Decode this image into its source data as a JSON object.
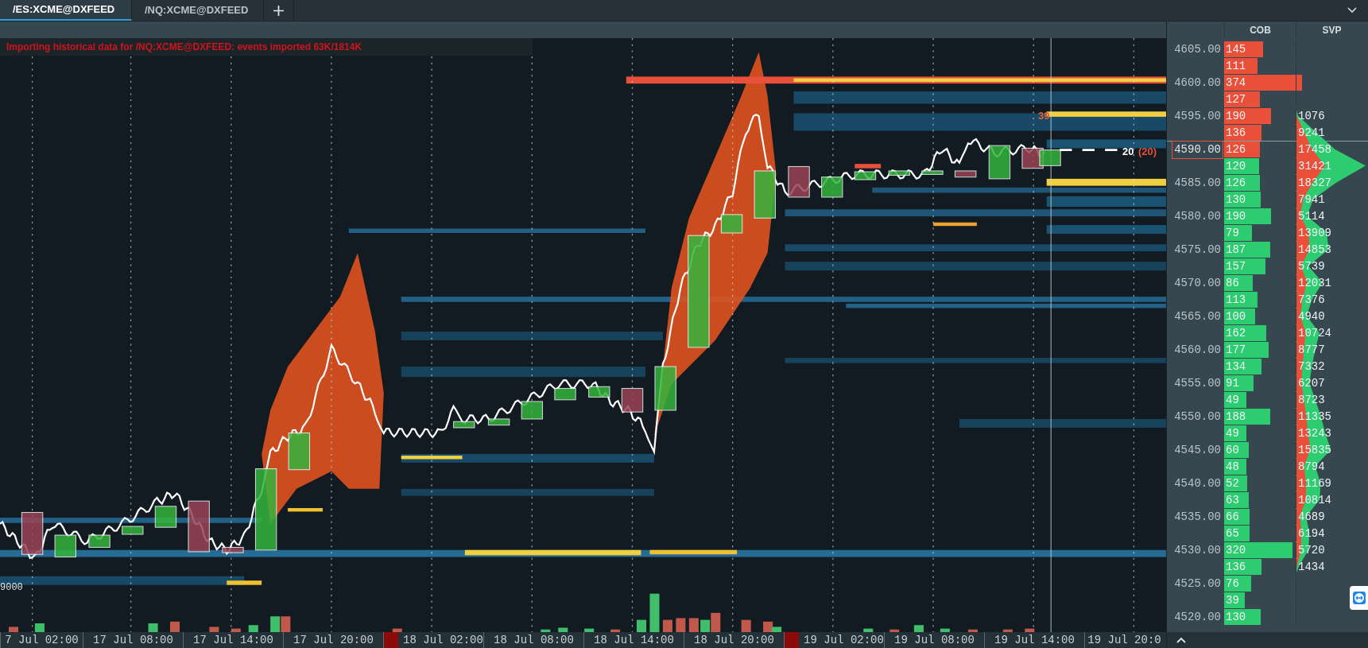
{
  "tabs": [
    {
      "label": "/ES:XCME@DXFEED",
      "selected": true
    },
    {
      "label": "/NQ:XCME@DXFEED",
      "selected": false
    }
  ],
  "status_message": "Importing historical data for /NQ:XCME@DXFEED: events imported 63K/1814K",
  "chart": {
    "left_label": "9000",
    "order_labels": [
      {
        "text": "39",
        "color": "#e8603a"
      }
    ],
    "current_order": {
      "size": "20",
      "total": "(20)"
    }
  },
  "time_axis": [
    {
      "label": "7 Jul 02:00",
      "marked": false
    },
    {
      "label": "17 Jul 08:00",
      "marked": false
    },
    {
      "label": "17 Jul 14:00",
      "marked": false
    },
    {
      "label": "17 Jul 20:00",
      "marked": false
    },
    {
      "label": "18 Jul 02:00",
      "marked": true
    },
    {
      "label": "18 Jul 08:00",
      "marked": false
    },
    {
      "label": "18 Jul 14:00",
      "marked": false
    },
    {
      "label": "18 Jul 20:00",
      "marked": false
    },
    {
      "label": "19 Jul 02:00",
      "marked": true
    },
    {
      "label": "19 Jul 08:00",
      "marked": false
    },
    {
      "label": "19 Jul 14:00",
      "marked": false
    },
    {
      "label": "19 Jul 20:0",
      "marked": false
    }
  ],
  "profile": {
    "columns": [
      "COB",
      "SVP"
    ],
    "rows": [
      {
        "price": "4605.00",
        "cob": "145",
        "color": "#e8503a",
        "current": false
      },
      {
        "cob": "111",
        "color": "#e8503a",
        "current": false
      },
      {
        "price": "4600.00",
        "cob": "374",
        "color": "#e8503a",
        "current": false
      },
      {
        "cob": "127",
        "color": "#e8503a",
        "current": false
      },
      {
        "price": "4595.00",
        "cob": "190",
        "color": "#e8503a",
        "svp": "1076",
        "current": false
      },
      {
        "cob": "136",
        "color": "#e8503a",
        "svp": "9241",
        "current": false
      },
      {
        "price": "4590.00",
        "cob": "126",
        "color": "#e8503a",
        "svp": "17458",
        "current": true
      },
      {
        "cob": "120",
        "color": "#2ecc71",
        "svp": "31421",
        "current": false
      },
      {
        "price": "4585.00",
        "cob": "126",
        "color": "#2ecc71",
        "svp": "18327",
        "current": false
      },
      {
        "cob": "130",
        "color": "#2ecc71",
        "svp": "7941",
        "current": false
      },
      {
        "price": "4580.00",
        "cob": "190",
        "color": "#2ecc71",
        "svp": "5114",
        "current": false
      },
      {
        "cob": "79",
        "color": "#2ecc71",
        "svp": "13909",
        "current": false
      },
      {
        "price": "4575.00",
        "cob": "187",
        "color": "#2ecc71",
        "svp": "14853",
        "current": false
      },
      {
        "cob": "157",
        "color": "#2ecc71",
        "svp": "5739",
        "current": false
      },
      {
        "price": "4570.00",
        "cob": "86",
        "color": "#2ecc71",
        "svp": "12031",
        "current": false
      },
      {
        "cob": "113",
        "color": "#2ecc71",
        "svp": "7376",
        "current": false
      },
      {
        "price": "4565.00",
        "cob": "100",
        "color": "#2ecc71",
        "svp": "4940",
        "current": false
      },
      {
        "cob": "162",
        "color": "#2ecc71",
        "svp": "10724",
        "current": false
      },
      {
        "price": "4560.00",
        "cob": "177",
        "color": "#2ecc71",
        "svp": "8777",
        "current": false
      },
      {
        "cob": "134",
        "color": "#2ecc71",
        "svp": "7332",
        "current": false
      },
      {
        "price": "4555.00",
        "cob": "91",
        "color": "#2ecc71",
        "svp": "6207",
        "current": false
      },
      {
        "cob": "49",
        "color": "#2ecc71",
        "svp": "8723",
        "current": false
      },
      {
        "price": "4550.00",
        "cob": "188",
        "color": "#2ecc71",
        "svp": "11335",
        "current": false
      },
      {
        "cob": "49",
        "color": "#2ecc71",
        "svp": "13243",
        "current": false
      },
      {
        "price": "4545.00",
        "cob": "60",
        "color": "#2ecc71",
        "svp": "15835",
        "current": false
      },
      {
        "cob": "48",
        "color": "#2ecc71",
        "svp": "8794",
        "current": false
      },
      {
        "price": "4540.00",
        "cob": "52",
        "color": "#2ecc71",
        "svp": "11169",
        "current": false
      },
      {
        "cob": "63",
        "color": "#2ecc71",
        "svp": "10814",
        "current": false
      },
      {
        "price": "4535.00",
        "cob": "66",
        "color": "#2ecc71",
        "svp": "4689",
        "current": false
      },
      {
        "cob": "65",
        "color": "#2ecc71",
        "svp": "6194",
        "current": false
      },
      {
        "price": "4530.00",
        "cob": "320",
        "color": "#2ecc71",
        "svp": "5720",
        "current": false
      },
      {
        "cob": "136",
        "color": "#2ecc71",
        "svp": "1434",
        "current": false
      },
      {
        "price": "4525.00",
        "cob": "76",
        "color": "#2ecc71",
        "current": false
      },
      {
        "cob": "39",
        "color": "#2ecc71",
        "current": false
      },
      {
        "price": "4520.00",
        "cob": "130",
        "color": "#2ecc71",
        "current": false
      }
    ]
  }
}
